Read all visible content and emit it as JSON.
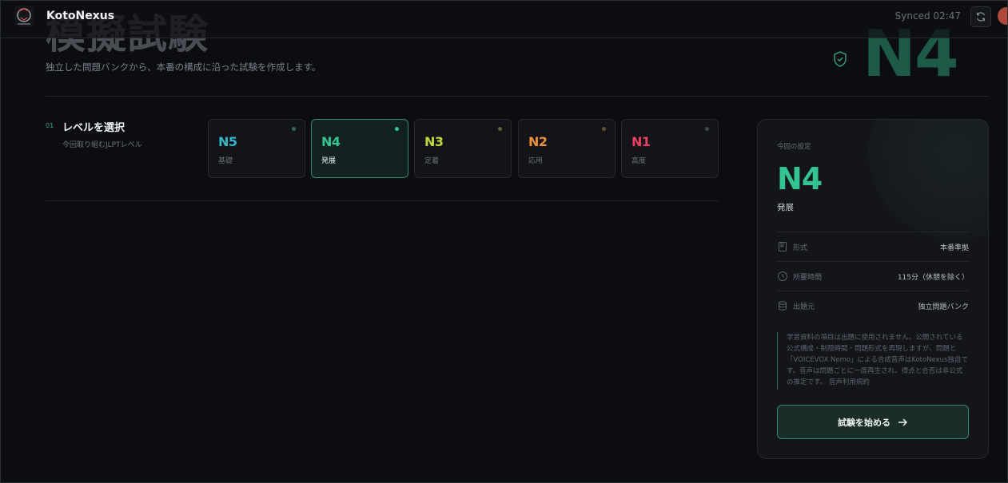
{
  "app": {
    "brand": "KotoNexus",
    "sync_status": "Synced 02:47"
  },
  "page": {
    "title": "模擬試験",
    "subtitle": "独立した問題バンクから、本番の構成に沿った試験を作成します。",
    "hero_level": "N4"
  },
  "step": {
    "number": "01",
    "title": "レベルを選択",
    "description": "今回取り組むJLPTレベル"
  },
  "levels": [
    {
      "code": "N5",
      "name": "基礎",
      "color": "#34b4c8",
      "dot": "#2f6a60",
      "selected": false
    },
    {
      "code": "N4",
      "name": "発展",
      "color": "#34c492",
      "dot": "#34c492",
      "selected": true
    },
    {
      "code": "N3",
      "name": "定着",
      "color": "#c3d63a",
      "dot": "#5c6132",
      "selected": false
    },
    {
      "code": "N2",
      "name": "応用",
      "color": "#f0913a",
      "dot": "#5c5232",
      "selected": false
    },
    {
      "code": "N1",
      "name": "高度",
      "color": "#ee3f5f",
      "dot": "#44474c",
      "selected": false
    }
  ],
  "summary": {
    "label": "今回の設定",
    "level": "N4",
    "level_name": "発展",
    "rows": [
      {
        "icon": "book-icon",
        "key": "形式",
        "value": "本番準拠"
      },
      {
        "icon": "clock-icon",
        "key": "所要時間",
        "value": "115分（休憩を除く）"
      },
      {
        "icon": "database-icon",
        "key": "出題元",
        "value": "独立問題バンク"
      }
    ],
    "note": "学習資料の項目は出題に使用されません。公開されている公式構成・制限時間・問題形式を再現しますが、問題と「VOICEVOX Nemo」による合成音声はKotoNexus独自です。音声は問題ごとに一度再生され、得点と合否は非公式の推定です。 音声利用規約",
    "start_label": "試験を始める"
  },
  "colors": {
    "accent": "#34c492",
    "background": "#0c0d11"
  }
}
